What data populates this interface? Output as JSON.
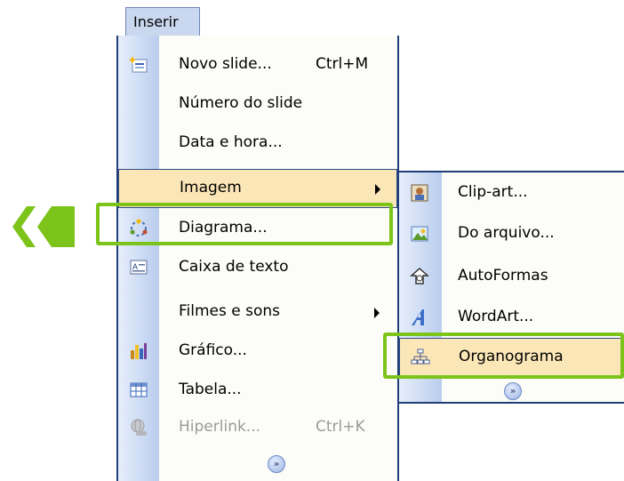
{
  "menu": {
    "title": "Inserir",
    "items": [
      {
        "label": "Novo slide...",
        "shortcut": "Ctrl+M",
        "icon": "new-slide-icon"
      },
      {
        "label": "Número do slide"
      },
      {
        "label": "Data e hora..."
      },
      {
        "label": "Imagem",
        "submenu": true
      },
      {
        "label": "Diagrama...",
        "icon": "diagram-icon"
      },
      {
        "label": "Caixa de texto",
        "icon": "text-box-icon"
      },
      {
        "label": "Filmes e sons",
        "submenu": true
      },
      {
        "label": "Gráfico...",
        "icon": "chart-icon"
      },
      {
        "label": "Tabela...",
        "icon": "table-icon"
      },
      {
        "label": "Hiperlink...",
        "shortcut": "Ctrl+K",
        "icon": "hyperlink-icon",
        "disabled": true
      }
    ],
    "more": "»"
  },
  "submenu": {
    "items": [
      {
        "label": "Clip-art...",
        "icon": "clip-art-icon"
      },
      {
        "label": "Do arquivo...",
        "icon": "from-file-icon"
      },
      {
        "label": "AutoFormas",
        "icon": "autoshapes-icon"
      },
      {
        "label": "WordArt...",
        "icon": "wordart-icon"
      },
      {
        "label": "Organograma",
        "icon": "org-chart-icon"
      }
    ],
    "more": "»"
  },
  "colors": {
    "highlight": "#fbe6b7",
    "callout": "#7cc31a",
    "menu_border": "#1f3e78"
  }
}
